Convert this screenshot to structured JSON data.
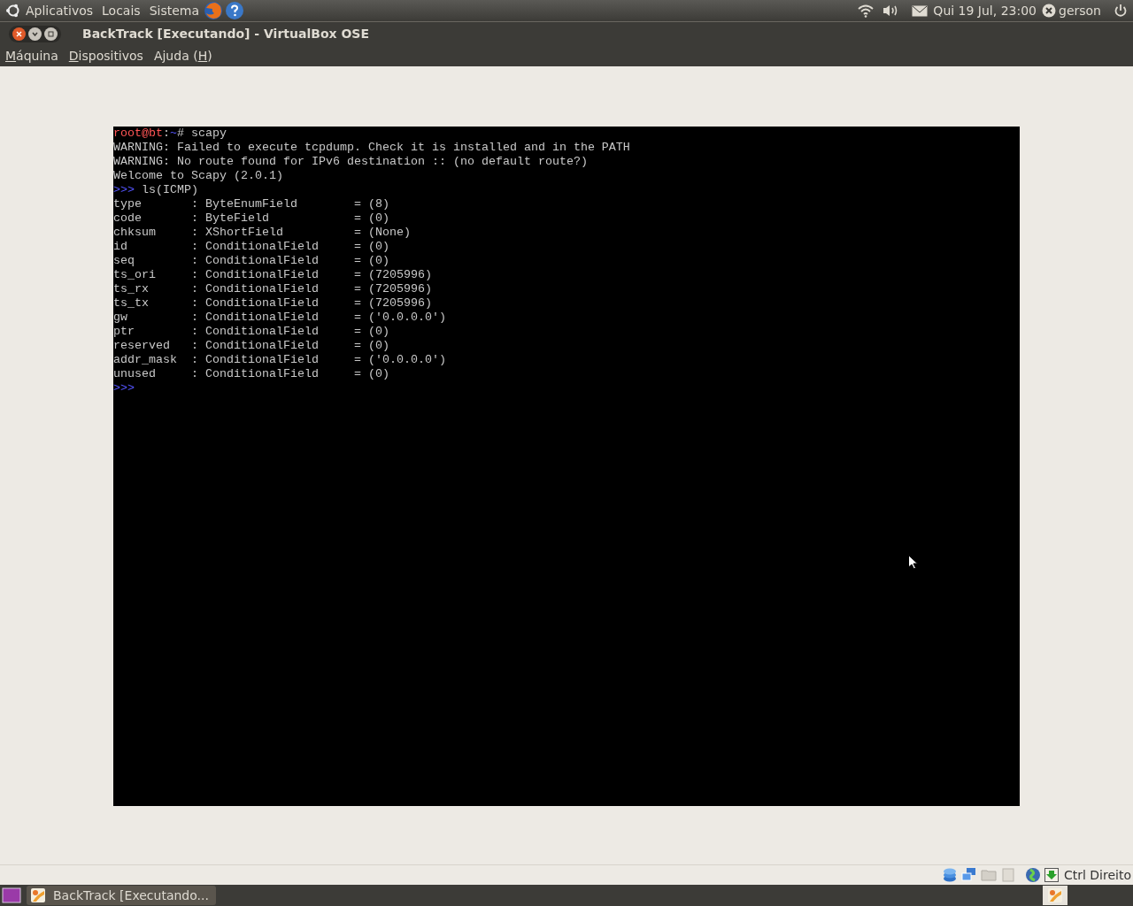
{
  "top_panel": {
    "menus": [
      "Aplicativos",
      "Locais",
      "Sistema"
    ],
    "clock": "Qui 19 Jul, 23:00",
    "user": "gerson"
  },
  "window": {
    "title": "BackTrack [Executando] - VirtualBox OSE"
  },
  "menubar": [
    {
      "key": "M",
      "after": "áquina"
    },
    {
      "key": "D",
      "after": "ispositivos"
    },
    {
      "before": "Ajuda (",
      "key": "H",
      "after": ")"
    }
  ],
  "terminal": {
    "lines": [
      [
        {
          "kind": "user",
          "text": "root@bt"
        },
        {
          "kind": "plain",
          "text": ":"
        },
        {
          "kind": "path",
          "text": "~"
        },
        {
          "kind": "plain",
          "text": "# scapy"
        }
      ],
      [
        {
          "kind": "plain",
          "text": "WARNING: Failed to execute tcpdump. Check it is installed and in the PATH"
        }
      ],
      [
        {
          "kind": "plain",
          "text": "WARNING: No route found for IPv6 destination :: (no default route?)"
        }
      ],
      [
        {
          "kind": "plain",
          "text": "Welcome to Scapy (2.0.1)"
        }
      ],
      [
        {
          "kind": "prompt",
          "text": ">>>"
        },
        {
          "kind": "plain",
          "text": " ls(ICMP)"
        }
      ],
      [
        {
          "kind": "plain",
          "text": "type       : ByteEnumField        = (8)"
        }
      ],
      [
        {
          "kind": "plain",
          "text": "code       : ByteField            = (0)"
        }
      ],
      [
        {
          "kind": "plain",
          "text": "chksum     : XShortField          = (None)"
        }
      ],
      [
        {
          "kind": "plain",
          "text": "id         : ConditionalField     = (0)"
        }
      ],
      [
        {
          "kind": "plain",
          "text": "seq        : ConditionalField     = (0)"
        }
      ],
      [
        {
          "kind": "plain",
          "text": "ts_ori     : ConditionalField     = (7205996)"
        }
      ],
      [
        {
          "kind": "plain",
          "text": "ts_rx      : ConditionalField     = (7205996)"
        }
      ],
      [
        {
          "kind": "plain",
          "text": "ts_tx      : ConditionalField     = (7205996)"
        }
      ],
      [
        {
          "kind": "plain",
          "text": "gw         : ConditionalField     = ('0.0.0.0')"
        }
      ],
      [
        {
          "kind": "plain",
          "text": "ptr        : ConditionalField     = (0)"
        }
      ],
      [
        {
          "kind": "plain",
          "text": "reserved   : ConditionalField     = (0)"
        }
      ],
      [
        {
          "kind": "plain",
          "text": "addr_mask  : ConditionalField     = ('0.0.0.0')"
        }
      ],
      [
        {
          "kind": "plain",
          "text": "unused     : ConditionalField     = (0)"
        }
      ],
      [
        {
          "kind": "prompt",
          "text": ">>>"
        }
      ]
    ]
  },
  "status_bar": {
    "host_key": "Ctrl Direito"
  },
  "taskbar": {
    "items": [
      {
        "label": "BackTrack [Executando...",
        "selected": true
      }
    ]
  }
}
